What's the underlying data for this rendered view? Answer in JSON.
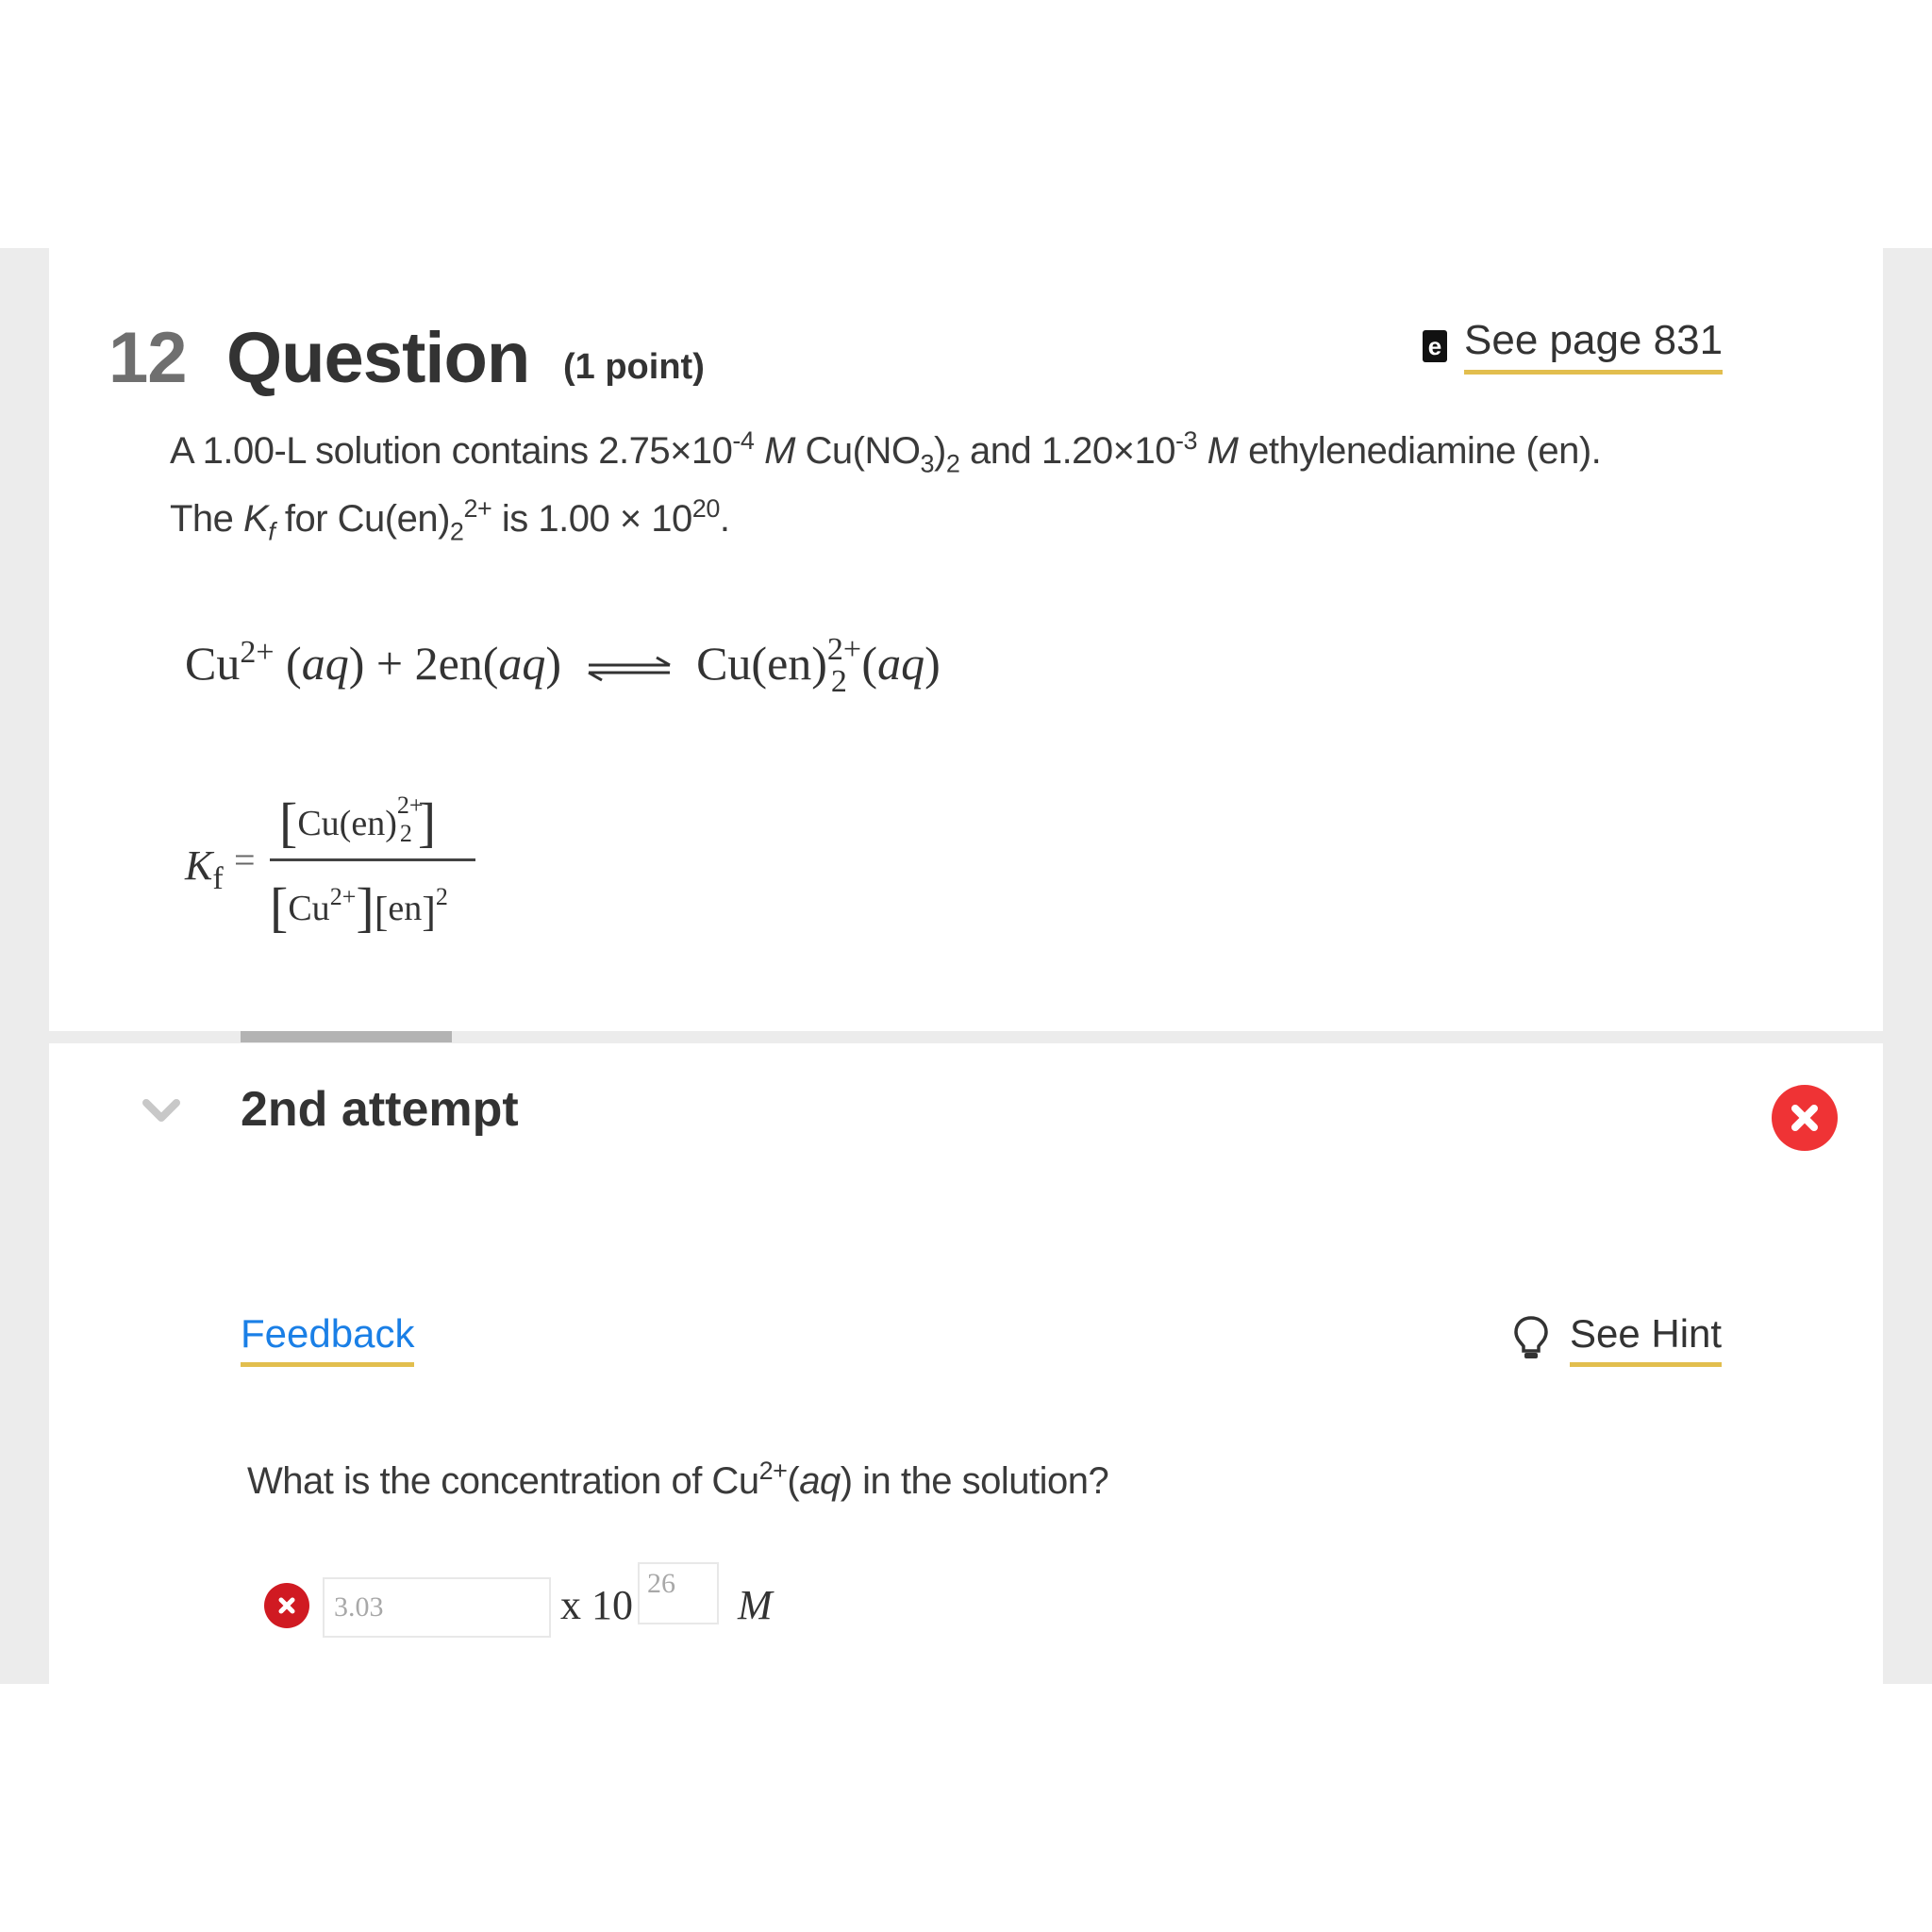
{
  "question": {
    "number": "12",
    "title": "Question",
    "points": "(1 point)",
    "ebook_link": {
      "icon": "ebook-icon",
      "label": "See page 831"
    },
    "stem": {
      "line1": {
        "p1": "A 1.00-L solution contains 2.75×10",
        "exp1": "-4",
        "unit1": "M",
        "p2": " Cu(NO",
        "sub1": "3",
        "p3": ")",
        "sub2": "2",
        "p4": " and 1.20×10",
        "exp2": "-3",
        "unit2": "M",
        "p5": " ethylenediamine (en)."
      },
      "line2": {
        "p1": "The ",
        "k": "K",
        "ksub": "f",
        "p2": " for Cu(en)",
        "sub": "2",
        "sup": "2+",
        "p3": " is 1.00 × 10",
        "exp": "20",
        "p4": "."
      }
    },
    "equation": {
      "reactant1": "Cu",
      "reactant1_charge": "2+",
      "phase": "aq",
      "plus": "+",
      "reactant2": "2en",
      "product": "Cu(en)",
      "product_sub": "2",
      "product_charge": "2+"
    },
    "kf_expression": {
      "label": "K",
      "label_sub": "f",
      "equals": "=",
      "numerator": "Cu(en)",
      "numerator_sub": "2",
      "numerator_charge": "2+",
      "den_cu": "Cu",
      "den_cu_charge": "2+",
      "den_en": "en",
      "den_en_power": "2"
    }
  },
  "attempt": {
    "label": "2nd attempt",
    "status": "incorrect",
    "progress_fraction": 0.115,
    "feedback_label": "Feedback",
    "hint_label": "See Hint",
    "sub_question": {
      "p1": "What is the concentration of Cu",
      "sup": "2+",
      "p2": "(",
      "phase": "aq",
      "p3": ") in the solution?"
    },
    "answer": {
      "mantissa": "3.03",
      "times_ten": "x 10",
      "exponent": "26",
      "unit": "M",
      "status": "incorrect"
    }
  },
  "colors": {
    "error_red": "#ef3335",
    "error_red_dark": "#d01a22",
    "link_blue": "#1a7fe6",
    "underline_gold": "#e2be4e",
    "background_gray": "#ececec"
  }
}
